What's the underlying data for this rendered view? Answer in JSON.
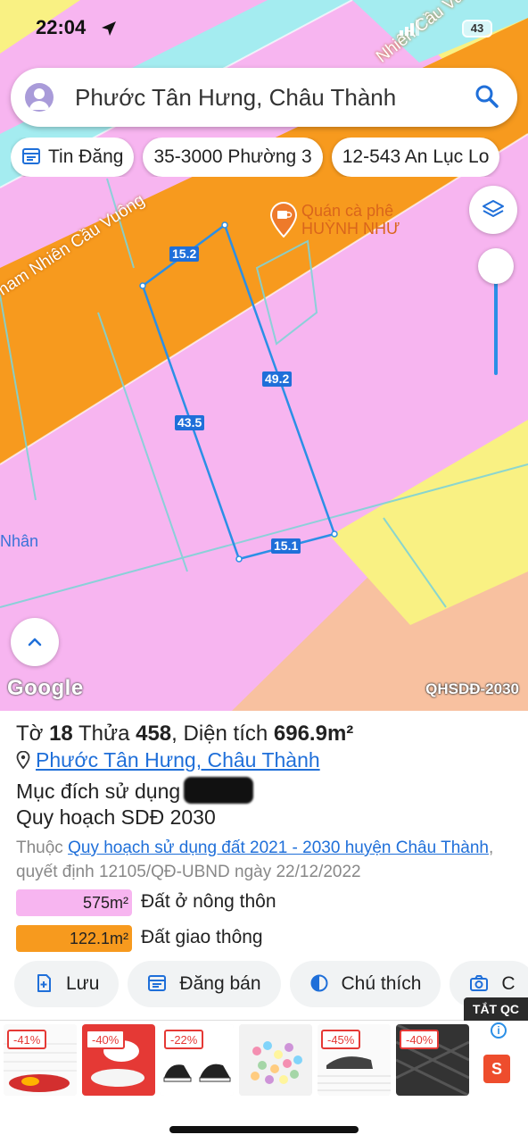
{
  "status_bar": {
    "time": "22:04",
    "battery": "43"
  },
  "search": {
    "query": "Phước Tân Hưng, Châu Thành"
  },
  "chips": [
    {
      "label": "Tin Đăng",
      "icon": "calendar-list-icon"
    },
    {
      "label": "35-3000 Phường 3"
    },
    {
      "label": "12-543 An Lục Lo"
    }
  ],
  "map": {
    "road_labels": [
      "nam Nhiên Cầu Vuông",
      "Nhiên Cầu Vu"
    ],
    "poi_name_1": "Quán cà phê",
    "poi_name_2": "HUỲNH NHƯ",
    "partial_label": "Nhân",
    "edge_lengths": {
      "top": "15.2",
      "right": "49.2",
      "left": "43.5",
      "bottom": "15.1"
    },
    "google_logo": "Google",
    "layer_tag": "QHSDĐ-2030",
    "colors": {
      "residential": "#f7b5f0",
      "transport": "#f79a1e",
      "agriculture": "#f9f183",
      "other": "#f8c1a0",
      "water": "#a4ecf0",
      "parcel_outline": "#2b8fe6"
    }
  },
  "panel": {
    "sheet_label": "Tờ",
    "sheet_number": "18",
    "plot_label": "Thửa",
    "plot_number": "458",
    "area_label": "Diện tích",
    "area_value": "696.9m²",
    "location": "Phước Tân Hưng, Châu Thành",
    "purpose_label": "Mục đích sử dụng",
    "plan_title": "Quy hoạch SDĐ 2030",
    "belongs_prefix": "Thuộc",
    "belongs_link": "Quy hoạch sử dụng đất 2021 - 2030 huyện Châu Thành",
    "belongs_suffix": ", quyết định 12105/QĐ-UBND ngày 22/12/2022",
    "land_uses": [
      {
        "area": "575m²",
        "name": "Đất ở nông thôn",
        "color": "#f7b5f0"
      },
      {
        "area": "122.1m²",
        "name": "Đất giao thông",
        "color": "#f79a1e"
      }
    ],
    "actions": [
      {
        "label": "Lưu",
        "icon": "bookmark-plus-icon"
      },
      {
        "label": "Đăng bán",
        "icon": "calendar-icon"
      },
      {
        "label": "Chú thích",
        "icon": "half-circle-icon"
      },
      {
        "label": "C",
        "icon": "camera-icon"
      }
    ]
  },
  "ads": {
    "close_label": "TẮT QC",
    "items": [
      {
        "badge": "-41%"
      },
      {
        "badge": "-40%"
      },
      {
        "badge": "-22%"
      },
      {
        "badge": ""
      },
      {
        "badge": "-45%"
      },
      {
        "badge": "-40%"
      }
    ],
    "shop_letter": "S"
  }
}
